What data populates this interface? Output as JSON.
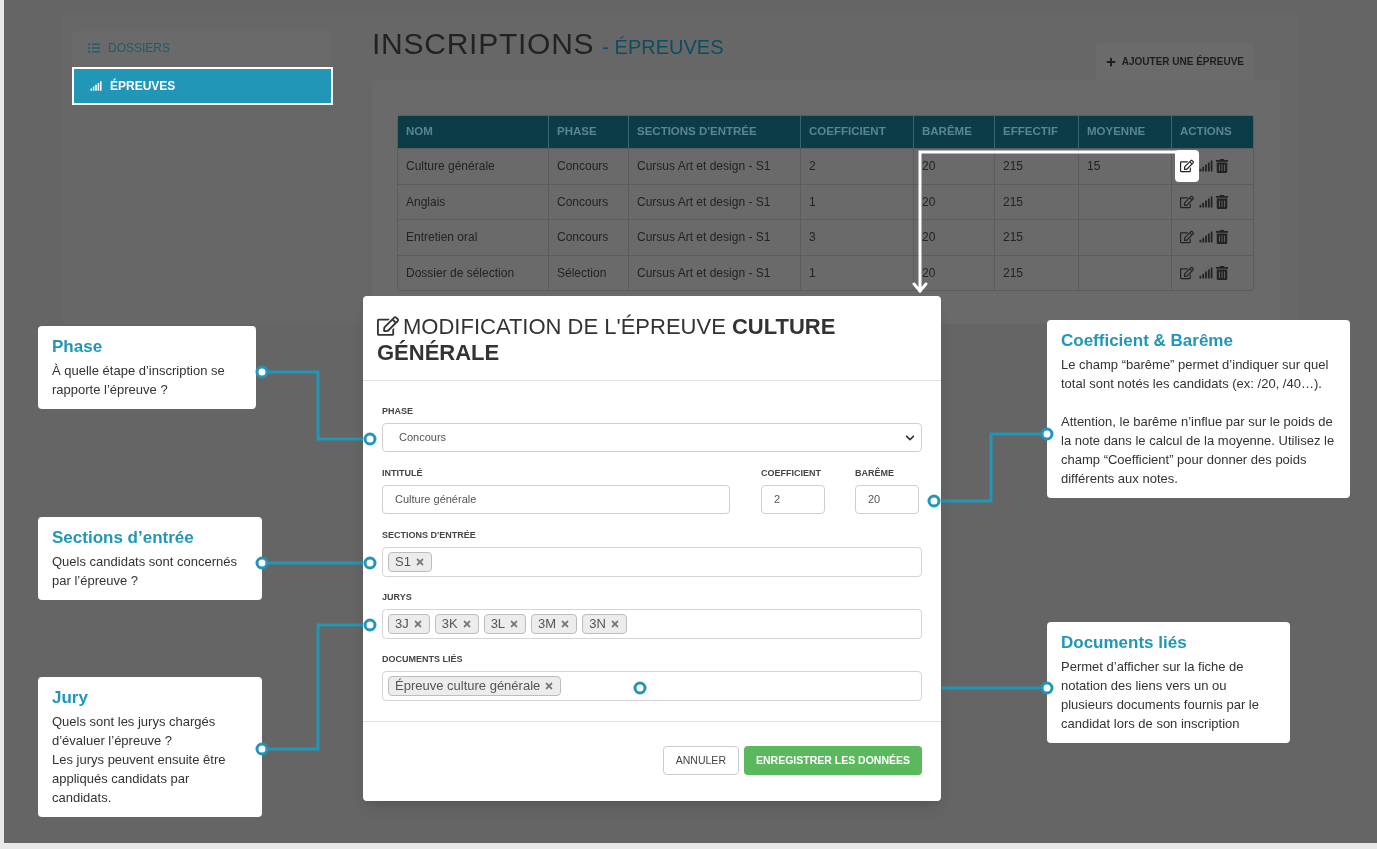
{
  "sidebar": {
    "items": [
      {
        "label": "DOSSIERS",
        "selected": false
      },
      {
        "label": "ÉPREUVES",
        "selected": true
      }
    ]
  },
  "page": {
    "title": "INSCRIPTIONS",
    "subtitle": "- ÉPREUVES",
    "add_button": "AJOUTER UNE ÉPREUVE"
  },
  "table": {
    "columns": [
      "NOM",
      "PHASE",
      "SECTIONS D'ENTRÉE",
      "COEFFICIENT",
      "BARÊME",
      "EFFECTIF",
      "MOYENNE",
      "ACTIONS"
    ],
    "rows": [
      {
        "cells": [
          "Culture générale",
          "Concours",
          "Cursus Art et design - S1",
          "2",
          "20",
          "215",
          "15"
        ],
        "highlighted": true
      },
      {
        "cells": [
          "Anglais",
          "Concours",
          "Cursus Art et design - S1",
          "1",
          "20",
          "215"
        ],
        "highlighted": false
      },
      {
        "cells": [
          "Entretien oral",
          "Concours",
          "Cursus Art et design - S1",
          "3",
          "20",
          "215"
        ],
        "highlighted": false
      },
      {
        "cells": [
          "Dossier de sélection",
          "Sélection",
          "Cursus Art et design - S1",
          "1",
          "20",
          "215"
        ],
        "highlighted": false
      }
    ]
  },
  "modal": {
    "title": "MODIFICATION DE L'ÉPREUVE **CULTURE GÉNÉRALE**",
    "phase": {
      "label": "PHASE",
      "value": "Concours"
    },
    "intitule": {
      "label": "INTITULÉ",
      "value": "Culture générale"
    },
    "coefficient": {
      "label": "COEFFICIENT",
      "value": "2"
    },
    "bareme": {
      "label": "BARÊME",
      "value": "20"
    },
    "sections": {
      "label": "SECTIONS D'ENTRÉE",
      "tags": [
        "S1"
      ]
    },
    "jurys": {
      "label": "JURYS",
      "tags": [
        "3J",
        "3K",
        "3L",
        "3M",
        "3N"
      ]
    },
    "documents": {
      "label": "DOCUMENTS LIÉS",
      "tags": [
        "Épreuve culture générale"
      ]
    },
    "buttons": {
      "cancel": "ANNULER",
      "save": "ENREGISTRER LES DONNÉES"
    }
  },
  "callouts": [
    {
      "title": "Phase",
      "paragraphs": [
        "À quelle étape d’inscription se rapporte l’épreuve ?"
      ]
    },
    {
      "title": "Sections d’entrée",
      "paragraphs": [
        "Quels candidats sont concernés par l’épreuve ?"
      ]
    },
    {
      "title": "Jury",
      "paragraphs": [
        "Quels sont les jurys chargés d’évaluer l’épreuve ?",
        "Les jurys peuvent ensuite être appliqués candidats par candidats."
      ],
      "spaced": false
    },
    {
      "title": "Coefficient & Barême",
      "paragraphs": [
        "Le champ “barême” permet d’indiquer sur quel total sont notés les candidats (ex: /20, /40…).",
        "Attention, le barême n’influe par sur le poids de la note dans le calcul de la moyenne. Utilisez le champ “Coefficient” pour donner des poids différents aux notes."
      ],
      "spaced": true
    },
    {
      "title": "Documents liés",
      "paragraphs": [
        "Permet d’afficher sur la fiche de notation des liens vers un ou plusieurs documents fournis par le candidat lors de son inscription"
      ]
    }
  ]
}
